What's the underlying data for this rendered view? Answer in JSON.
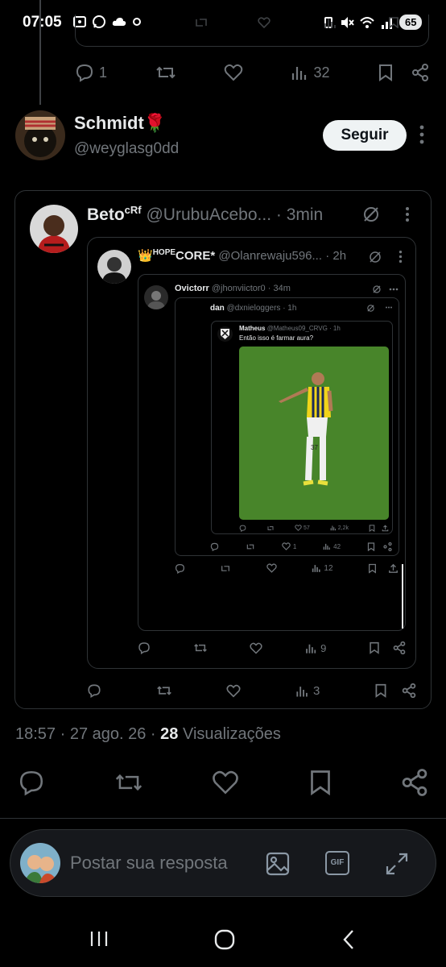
{
  "status_bar": {
    "time": "07:05",
    "battery": "65"
  },
  "previous_tweet": {
    "reply_count": "1",
    "views": "32"
  },
  "author": {
    "name": "Schmidt🌹",
    "handle": "@weyglasg0dd",
    "follow_label": "Seguir"
  },
  "quote1": {
    "name": "Beto",
    "name_sup": "cRf",
    "handle": "@UrubuAcebo...",
    "time": "· 3min",
    "views": "3"
  },
  "quote2": {
    "name_sup": "HOPE",
    "name": "CORE*",
    "handle": "@Olanrewaju596...",
    "time": "· 2h",
    "views": "9"
  },
  "quote3": {
    "name": "Ovictorr",
    "handle": "@jhonviictor0",
    "time": "· 34m",
    "views": "12"
  },
  "quote4": {
    "name": "dan",
    "handle": "@dxnieloggers",
    "time": "· 1h",
    "replies": "1",
    "views": "42"
  },
  "quote5": {
    "name": "Matheus",
    "handle": "@Matheus09_CRVG",
    "time": "· 1h",
    "text": "Então isso é farmar aura?",
    "likes": "57",
    "views": "2,2k",
    "jersey": "37"
  },
  "tweet_meta": {
    "time": "18:57",
    "date": "· 27 ago. 26 ·",
    "views_count": "28",
    "views_label": "Visualizações"
  },
  "reply_box": {
    "placeholder": "Postar sua resposta",
    "gif_label": "GIF"
  },
  "colors": {
    "background": "#000000",
    "border": "#2f3336",
    "muted": "#71767b",
    "text": "#e7e9ea",
    "pitch": "#4e8a2d"
  }
}
